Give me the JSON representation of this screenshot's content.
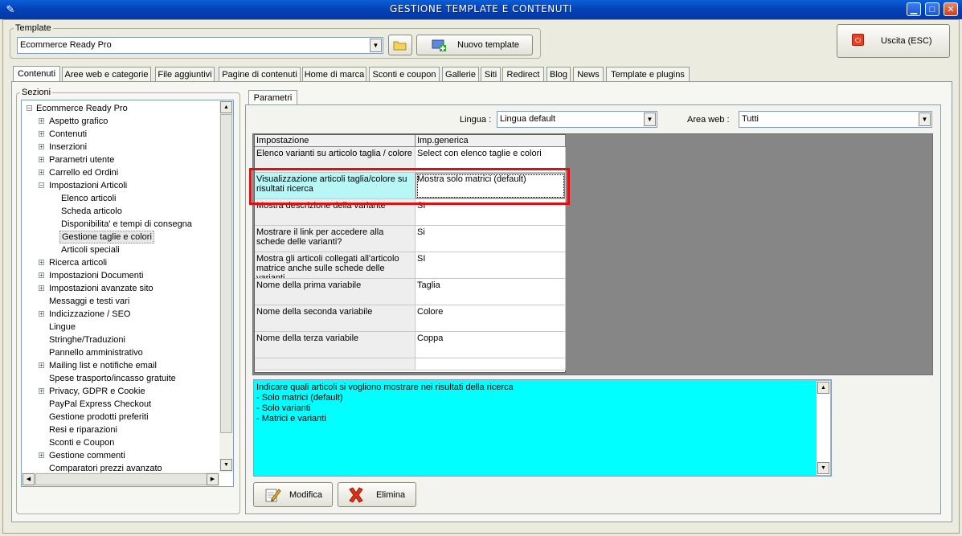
{
  "window": {
    "title": "GESTIONE TEMPLATE E CONTENUTI"
  },
  "template": {
    "group_label": "Template",
    "selected": "Ecommerce Ready Pro",
    "new_button": "Nuovo template"
  },
  "exit_button": "Uscita (ESC)",
  "tabs": [
    "Contenuti",
    "Aree web e categorie",
    "File aggiuntivi",
    "Pagine di contenuti",
    "Home di marca",
    "Sconti e coupon",
    "Gallerie",
    "Siti",
    "Redirect",
    "Blog",
    "News",
    "Template e plugins"
  ],
  "sections": {
    "label": "Sezioni",
    "root": "Ecommerce Ready Pro",
    "items": [
      {
        "label": "Aspetto grafico",
        "level": 1,
        "expander": "+"
      },
      {
        "label": "Contenuti",
        "level": 1,
        "expander": "+"
      },
      {
        "label": "Inserzioni",
        "level": 1,
        "expander": "+"
      },
      {
        "label": "Parametri utente",
        "level": 1,
        "expander": "+"
      },
      {
        "label": "Carrello ed Ordini",
        "level": 1,
        "expander": "+"
      },
      {
        "label": "Impostazioni Articoli",
        "level": 1,
        "expander": "-"
      },
      {
        "label": "Elenco articoli",
        "level": 2,
        "expander": ""
      },
      {
        "label": "Scheda articolo",
        "level": 2,
        "expander": ""
      },
      {
        "label": "Disponibilita' e tempi di consegna",
        "level": 2,
        "expander": ""
      },
      {
        "label": "Gestione taglie e colori",
        "level": 2,
        "expander": "",
        "selected": true
      },
      {
        "label": "Articoli speciali",
        "level": 2,
        "expander": ""
      },
      {
        "label": "Ricerca articoli",
        "level": 1,
        "expander": "+"
      },
      {
        "label": "Impostazioni Documenti",
        "level": 1,
        "expander": "+"
      },
      {
        "label": "Impostazioni avanzate sito",
        "level": 1,
        "expander": "+"
      },
      {
        "label": "Messaggi e testi vari",
        "level": 1,
        "expander": ""
      },
      {
        "label": "Indicizzazione / SEO",
        "level": 1,
        "expander": "+"
      },
      {
        "label": "Lingue",
        "level": 1,
        "expander": ""
      },
      {
        "label": "Stringhe/Traduzioni",
        "level": 1,
        "expander": ""
      },
      {
        "label": "Pannello amministrativo",
        "level": 1,
        "expander": ""
      },
      {
        "label": "Mailing list e notifiche email",
        "level": 1,
        "expander": "+"
      },
      {
        "label": "Spese trasporto/incasso gratuite",
        "level": 1,
        "expander": ""
      },
      {
        "label": "Privacy, GDPR e Cookie",
        "level": 1,
        "expander": "+"
      },
      {
        "label": "PayPal Express Checkout",
        "level": 1,
        "expander": ""
      },
      {
        "label": "Gestione prodotti preferiti",
        "level": 1,
        "expander": ""
      },
      {
        "label": "Resi e riparazioni",
        "level": 1,
        "expander": ""
      },
      {
        "label": "Sconti e Coupon",
        "level": 1,
        "expander": ""
      },
      {
        "label": "Gestione commenti",
        "level": 1,
        "expander": "+"
      },
      {
        "label": "Comparatori prezzi avanzato",
        "level": 1,
        "expander": ""
      }
    ]
  },
  "params": {
    "tab": "Parametri",
    "lingua_label": "Lingua :",
    "lingua_value": "Lingua default",
    "area_label": "Area web :",
    "area_value": "Tutti",
    "columns": [
      "Impostazione",
      "Imp.generica"
    ],
    "rows": [
      {
        "k": "Elenco varianti su articolo taglia / colore",
        "v": "Select con elenco taglie e colori"
      },
      {
        "k": "Visualizzazione articoli taglia/colore su risultati ricerca",
        "v": "Mostra solo matrici (default)"
      },
      {
        "k": "Mostra descrizione della variante",
        "v": "SI"
      },
      {
        "k": "Mostrare il link per accedere alla schede delle varianti?",
        "v": "Si"
      },
      {
        "k": "Mostra gli articoli collegati all'articolo matrice anche sulle schede delle varianti",
        "v": "SI"
      },
      {
        "k": "Nome della prima variabile",
        "v": "Taglia"
      },
      {
        "k": "Nome della seconda variabile",
        "v": "Colore"
      },
      {
        "k": "Nome della terza variabile",
        "v": "Coppa"
      },
      {
        "k": "",
        "v": ""
      }
    ],
    "description": [
      "Indicare quali articoli si vogliono mostrare nei risultati della ricerca",
      "- Solo matrici (default)",
      "- Solo varianti",
      "- Matrici e varianti"
    ],
    "modify_button": "Modifica",
    "delete_button": "Elimina"
  }
}
